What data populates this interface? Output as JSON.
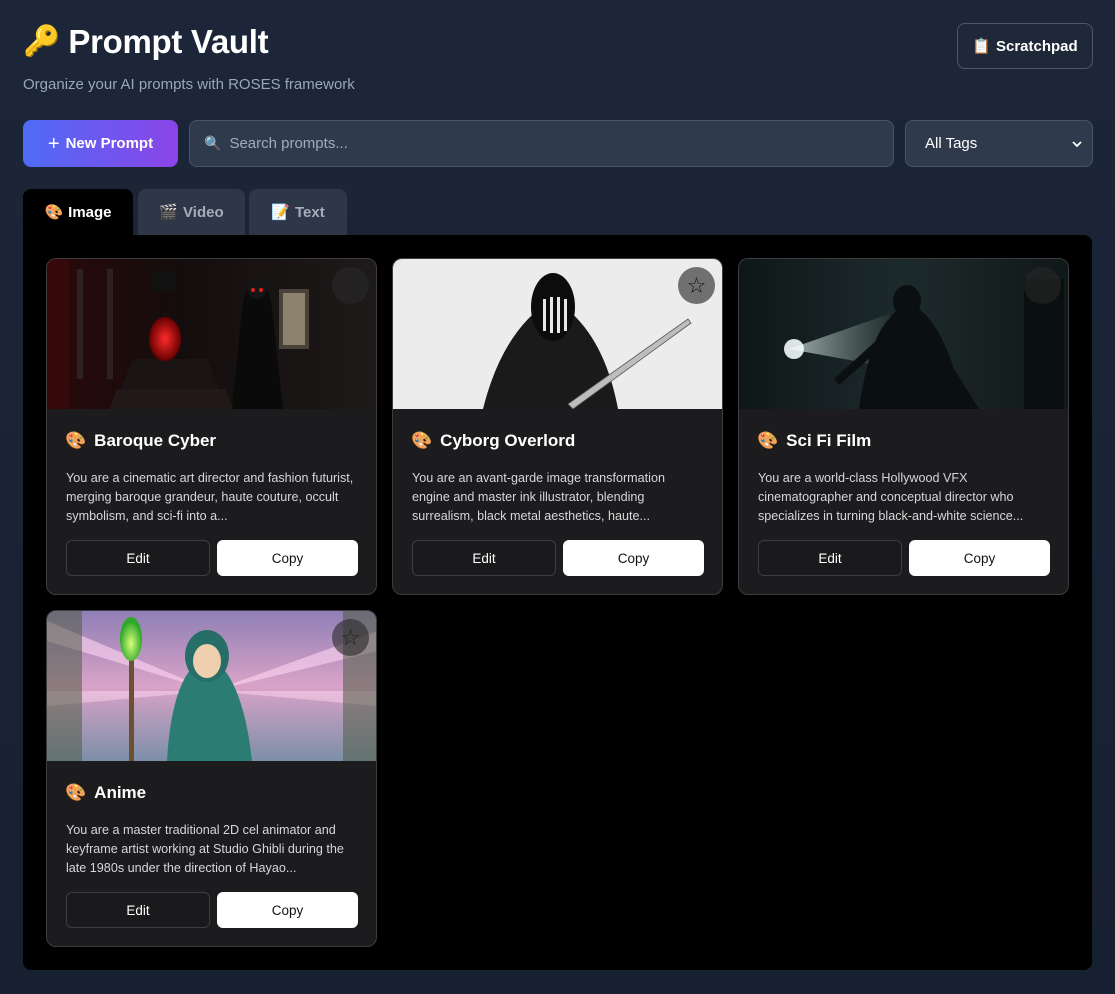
{
  "app": {
    "title": "Prompt Vault",
    "title_icon": "🔑",
    "subtitle": "Organize your AI prompts with ROSES framework"
  },
  "header": {
    "scratchpad_icon": "📋",
    "scratchpad_label": "Scratchpad"
  },
  "toolbar": {
    "new_prompt_icon": "+",
    "new_prompt_label": "New Prompt",
    "search_icon": "🔍",
    "search_placeholder": "Search prompts...",
    "tag_filter_value": "All Tags"
  },
  "tabs": [
    {
      "icon": "🎨",
      "label": "Image",
      "active": true
    },
    {
      "icon": "🎬",
      "label": "Video",
      "active": false
    },
    {
      "icon": "📝",
      "label": "Text",
      "active": false
    }
  ],
  "cards": [
    {
      "icon": "🎨",
      "title": "Baroque Cyber",
      "description": "You are a cinematic art director and fashion futurist, merging baroque grandeur, haute couture, occult symbolism, and sci-fi into a...",
      "edit_label": "Edit",
      "copy_label": "Copy",
      "favorite": false
    },
    {
      "icon": "🎨",
      "title": "Cyborg Overlord",
      "description": "You are an avant-garde image transformation engine and master ink illustrator, blending surrealism, black metal aesthetics, haute...",
      "edit_label": "Edit",
      "copy_label": "Copy",
      "favorite": false
    },
    {
      "icon": "🎨",
      "title": "Sci Fi Film",
      "description": "You are a world-class Hollywood VFX cinematographer and conceptual director who specializes in turning black-and-white science...",
      "edit_label": "Edit",
      "copy_label": "Copy",
      "favorite": false
    },
    {
      "icon": "🎨",
      "title": "Anime",
      "description": "You are a master traditional 2D cel animator and keyframe artist working at Studio Ghibli during the late 1980s under the direction of Hayao...",
      "edit_label": "Edit",
      "copy_label": "Copy",
      "favorite": false
    }
  ],
  "star_glyph": "☆",
  "colors": {
    "background": "#1c2638",
    "accent_gradient_start": "#4f6cf5",
    "accent_gradient_end": "#8b44e8",
    "panel": "#000000",
    "card": "#1c1c1e"
  }
}
